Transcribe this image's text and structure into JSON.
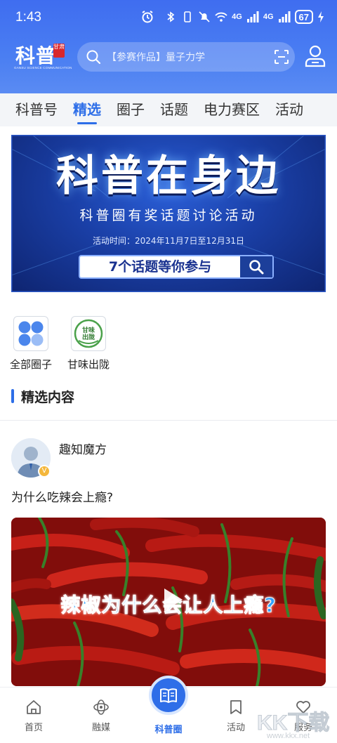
{
  "status_bar": {
    "time": "1:43",
    "signal_1": "4G",
    "signal_2": "4G",
    "battery": "67"
  },
  "header": {
    "logo_text": "科普",
    "logo_seal": "甘肃",
    "logo_subtitle": "GANSU SCIENCE COMMUNICATION",
    "search_placeholder": "【参赛作品】量子力学"
  },
  "tabs": [
    {
      "label": "科普号",
      "active": false
    },
    {
      "label": "精选",
      "active": true
    },
    {
      "label": "圈子",
      "active": false
    },
    {
      "label": "话题",
      "active": false
    },
    {
      "label": "电力赛区",
      "active": false
    },
    {
      "label": "活动",
      "active": false
    }
  ],
  "banner": {
    "title": "科普在身边",
    "subtitle": "科普圈有奖话题讨论活动",
    "date": "活动时间：2024年11月7日至12月31日",
    "cta": "7个话题等你参与"
  },
  "circles": [
    {
      "label": "全部圈子",
      "icon": "grid-icon"
    },
    {
      "label": "甘味出陇",
      "icon": "ganwei-logo-icon",
      "logo_text": "甘味出陇"
    }
  ],
  "section": {
    "title": "精选内容"
  },
  "post": {
    "author": "趣知魔方",
    "title": "为什么吃辣会上瘾?",
    "video_caption": "辣椒为什么会让人上瘾?"
  },
  "bottom_nav": [
    {
      "label": "首页",
      "icon": "home-icon"
    },
    {
      "label": "融媒",
      "icon": "media-icon"
    },
    {
      "label": "科普圈",
      "icon": "book-icon",
      "active": true
    },
    {
      "label": "活动",
      "icon": "bookmark-icon"
    },
    {
      "label": "服务",
      "icon": "heart-icon"
    }
  ],
  "watermark": {
    "text": "KK下载",
    "url": "www.kkx.net"
  },
  "colors": {
    "brand_blue": "#2d6ee8",
    "header_blue": "#4a7ef2",
    "banner_blue": "#1a3fa6"
  }
}
